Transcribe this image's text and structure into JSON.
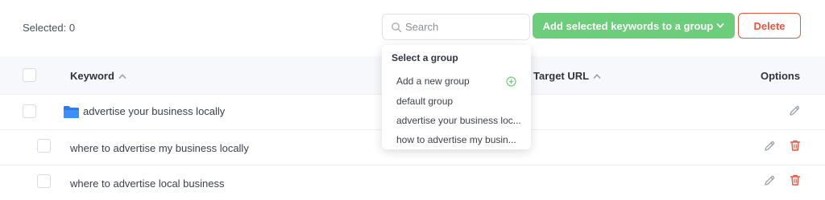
{
  "toolbar": {
    "selected_label": "Selected: 0",
    "search_placeholder": "Search",
    "add_button_label": "Add selected keywords to a group",
    "delete_button_label": "Delete",
    "accent_green": "#6ccd7a",
    "danger_red": "#e8553e"
  },
  "table": {
    "headers": {
      "keyword": "Keyword",
      "target_url": "Target URL",
      "options": "Options"
    },
    "rows": [
      {
        "keyword": "advertise your business locally",
        "is_group": true,
        "actions": [
          "pencil-icon"
        ]
      },
      {
        "keyword": "where to advertise my business locally",
        "is_group": false,
        "actions": [
          "pencil-icon",
          "trash-icon"
        ]
      },
      {
        "keyword": "where to advertise local business",
        "is_group": false,
        "actions": [
          "pencil-icon",
          "trash-icon"
        ]
      }
    ]
  },
  "group_dropdown": {
    "header": "Select a group",
    "items": [
      "Add a new group",
      "default group",
      "advertise your business loc...",
      "how to advertise my busin..."
    ]
  }
}
